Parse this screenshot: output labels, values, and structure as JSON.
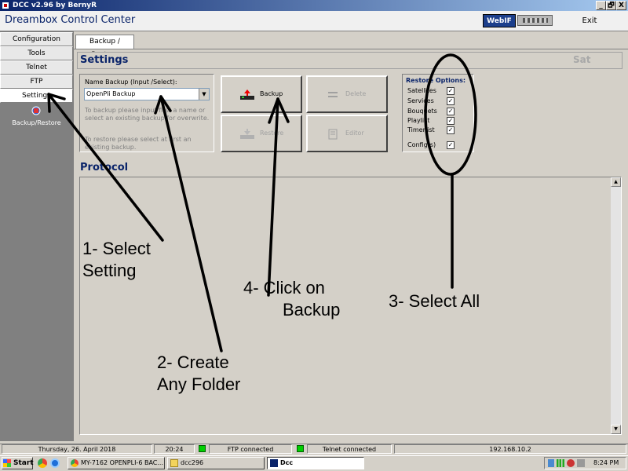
{
  "window": {
    "title": "DCC v2.96 by BernyR",
    "controls": [
      "_",
      "🗗",
      "X"
    ]
  },
  "app": {
    "title": "Dreambox Control Center",
    "webif_label": "WebIF",
    "exit_label": "Exit"
  },
  "sidebar": {
    "items": [
      {
        "label": "Configuration"
      },
      {
        "label": "Tools"
      },
      {
        "label": "Telnet"
      },
      {
        "label": "FTP"
      },
      {
        "label": "Settings"
      }
    ],
    "sub_item": {
      "label": "Backup/Restore",
      "icon": "backup-restore-icon"
    }
  },
  "tabs": [
    {
      "label": "Backup / Restore"
    }
  ],
  "settings": {
    "title": "Settings",
    "right_label": "Sat",
    "name_label": "Name Backup (Input /Select):",
    "name_value": "OpenPli Backup",
    "hint_backup": "To backup please input first a name or select an existing backup for overwrite.",
    "hint_restore": "To restore please select at first an existing backup.",
    "buttons": {
      "backup": "Backup",
      "delete": "Delete",
      "restore": "Restore",
      "editor": "Editor"
    },
    "restore_options": {
      "title": "Restore Options:",
      "items": [
        {
          "label": "Satellites",
          "checked": true
        },
        {
          "label": "Services",
          "checked": true
        },
        {
          "label": "Bouquets",
          "checked": true
        },
        {
          "label": "Playlist",
          "checked": true
        },
        {
          "label": "Timerlist",
          "checked": true
        },
        {
          "label": "Config(s)",
          "checked": true
        }
      ]
    }
  },
  "protocol": {
    "title": "Protocol"
  },
  "statusbar": {
    "date": "Thursday, 26. April 2018",
    "time": "20:24",
    "ftp": "FTP connected",
    "telnet": "Telnet connected",
    "ip": "192.168.10.2"
  },
  "taskbar": {
    "start_label": "Start",
    "tasks": [
      {
        "label": "MY-7162 OPENPLI-6 BAC..."
      },
      {
        "label": "dcc296"
      },
      {
        "label": "Dcc"
      }
    ],
    "clock": "8:24 PM"
  },
  "annotations": {
    "step1_line1": "1- Select",
    "step1_line2": "Setting",
    "step2_line1": "2- Create",
    "step2_line2": "Any Folder",
    "step3": "3- Select All",
    "step4_line1": "4- Click on",
    "step4_line2": "Backup"
  }
}
